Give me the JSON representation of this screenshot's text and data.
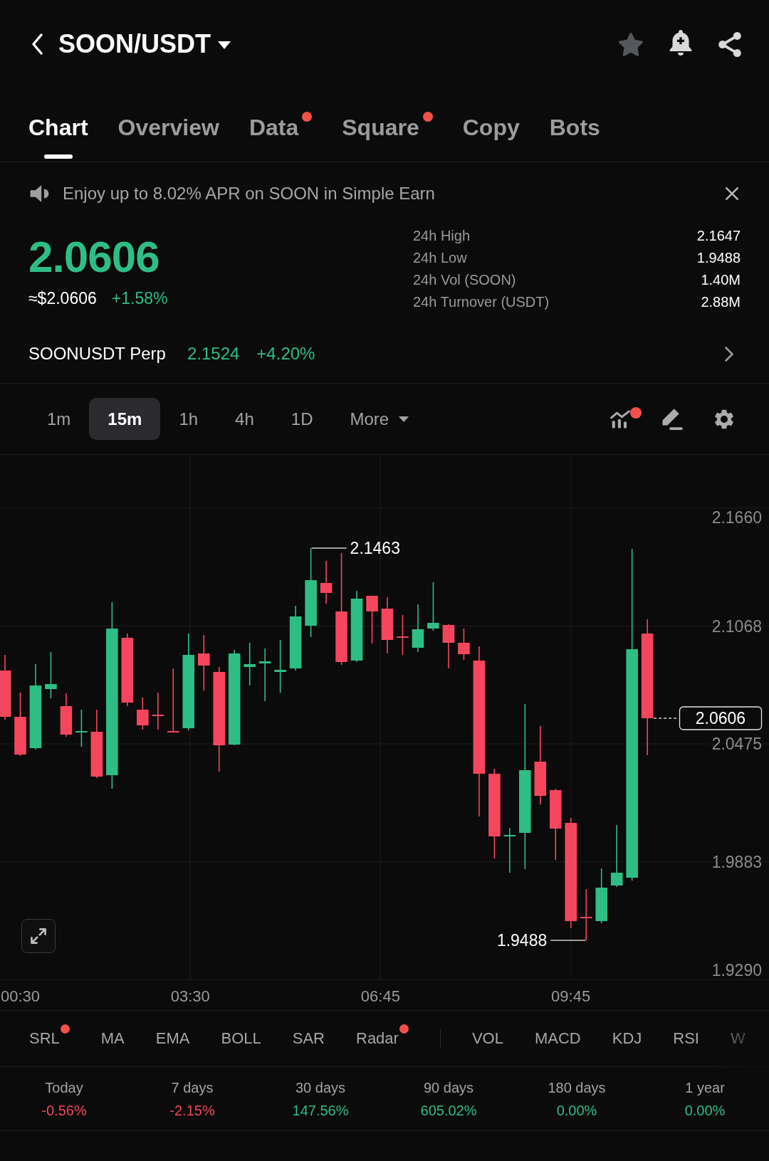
{
  "header": {
    "title": "SOON/USDT",
    "favorited": false
  },
  "tabs": [
    {
      "label": "Chart",
      "selected": true,
      "dot": false
    },
    {
      "label": "Overview",
      "selected": false,
      "dot": false
    },
    {
      "label": "Data",
      "selected": false,
      "dot": true
    },
    {
      "label": "Square",
      "selected": false,
      "dot": true
    },
    {
      "label": "Copy",
      "selected": false,
      "dot": false
    },
    {
      "label": "Bots",
      "selected": false,
      "dot": false
    }
  ],
  "banner": {
    "text": "Enjoy up to 8.02% APR on SOON in Simple Earn"
  },
  "ticker": {
    "price": "2.0606",
    "fiat_price": "≈$2.0606",
    "change": "+1.58%",
    "rising": true,
    "stats": [
      {
        "label": "24h High",
        "value": "2.1647"
      },
      {
        "label": "24h Low",
        "value": "1.9488"
      },
      {
        "label": "24h Vol (SOON)",
        "value": "1.40M"
      },
      {
        "label": "24h Turnover (USDT)",
        "value": "2.88M"
      }
    ]
  },
  "perpetual": {
    "name": "SOONUSDT Perp",
    "price": "2.1524",
    "change": "+4.20%",
    "rising": true
  },
  "intervals": [
    {
      "label": "1m",
      "selected": false
    },
    {
      "label": "15m",
      "selected": true
    },
    {
      "label": "1h",
      "selected": false
    },
    {
      "label": "4h",
      "selected": false
    },
    {
      "label": "1D",
      "selected": false
    }
  ],
  "more_button": {
    "label": "More"
  },
  "chart_tools": {
    "indicator_dot": true
  },
  "chart": {
    "price_axis": [
      "2.1660",
      "2.1068",
      "2.0475",
      "1.9883",
      "1.9290"
    ],
    "time_axis": [
      "00:30",
      "03:30",
      "06:45",
      "09:45"
    ],
    "high_marker": "2.1463",
    "low_marker": "1.9488",
    "last_price_tag": "2.0606"
  },
  "indicators": {
    "main": [
      {
        "label": "SRL",
        "dot": true
      },
      {
        "label": "MA",
        "dot": false
      },
      {
        "label": "EMA",
        "dot": false
      },
      {
        "label": "BOLL",
        "dot": false
      },
      {
        "label": "SAR",
        "dot": false
      },
      {
        "label": "Radar",
        "dot": true
      }
    ],
    "sub": [
      {
        "label": "VOL",
        "dot": false
      },
      {
        "label": "MACD",
        "dot": false
      },
      {
        "label": "KDJ",
        "dot": false
      },
      {
        "label": "RSI",
        "dot": false
      },
      {
        "label": "W",
        "dot": false
      }
    ]
  },
  "performance": [
    {
      "label": "Today",
      "value": "-0.56%",
      "color": "#f0475b"
    },
    {
      "label": "7 days",
      "value": "-2.15%",
      "color": "#f0475b"
    },
    {
      "label": "30 days",
      "value": "147.56%",
      "color": "#2ebd85"
    },
    {
      "label": "90 days",
      "value": "605.02%",
      "color": "#2ebd85"
    },
    {
      "label": "180 days",
      "value": "0.00%",
      "color": "#2ebd85"
    },
    {
      "label": "1 year",
      "value": "0.00%",
      "color": "#2ebd85"
    }
  ]
}
